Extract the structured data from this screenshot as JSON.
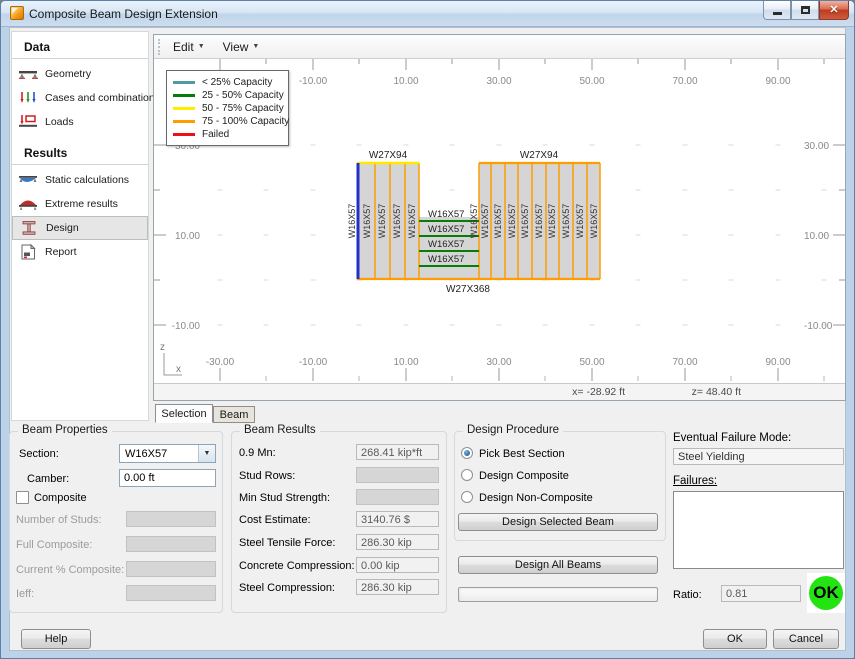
{
  "window": {
    "title": "Composite Beam Design Extension"
  },
  "sidebar": {
    "sections": [
      {
        "header": "Data",
        "items": [
          {
            "label": "Geometry"
          },
          {
            "label": "Cases and combinations"
          },
          {
            "label": "Loads"
          }
        ]
      },
      {
        "header": "Results",
        "items": [
          {
            "label": "Static calculations"
          },
          {
            "label": "Extreme results"
          },
          {
            "label": "Design",
            "selected": true
          },
          {
            "label": "Report"
          }
        ]
      }
    ]
  },
  "menubar": {
    "items": [
      {
        "label": "Edit"
      },
      {
        "label": "View"
      }
    ]
  },
  "legend": {
    "items": [
      {
        "label": "< 25% Capacity",
        "color": "#4f9ba0"
      },
      {
        "label": "25 - 50% Capacity",
        "color": "#067d06"
      },
      {
        "label": "50 - 75% Capacity",
        "color": "#ffee00"
      },
      {
        "label": "75 - 100% Capacity",
        "color": "#ff9c00"
      },
      {
        "label": "Failed",
        "color": "#ee1111"
      }
    ]
  },
  "plot": {
    "top_ticks": [
      "-10.00",
      "10.00",
      "30.00",
      "50.00",
      "70.00",
      "90.00"
    ],
    "bottom_ticks": [
      "-30.00",
      "-10.00",
      "10.00",
      "30.00",
      "50.00",
      "70.00",
      "90.00"
    ],
    "left_ticks": [
      "30.00",
      "10.00",
      "-10.00"
    ],
    "right_ticks": [
      "30.00",
      "10.00",
      "-10.00"
    ],
    "axis_z_label": "z",
    "axis_x_label": "x",
    "beams": {
      "top_left_girder": "W27X94",
      "top_right_girder": "W27X94",
      "bottom_girder": "W27X368",
      "vertical_beam": "W16X57",
      "middle_beam": "W16X57"
    },
    "colors": {
      "vertical": "#ff9d00",
      "selected": "#2230c8",
      "middle": "#067d06",
      "top_left": "#ffe900",
      "fill": "#d5d5d5"
    },
    "status": {
      "x": "x= -28.92 ft",
      "z": "z= 48.40 ft"
    }
  },
  "tabs": [
    {
      "label": "Selection",
      "active": true
    },
    {
      "label": "Beam",
      "active": false
    }
  ],
  "beam_properties": {
    "title": "Beam Properties",
    "section_label": "Section:",
    "section_value": "W16X57",
    "camber_label": "Camber:",
    "camber_value": "0.00 ft",
    "composite_label": "Composite",
    "composite_checked": false,
    "disabled_rows": [
      {
        "label": "Number of Studs:",
        "value": ""
      },
      {
        "label": "Full Composite:",
        "value": ""
      },
      {
        "label": "Current % Composite:",
        "value": ""
      },
      {
        "label": "Ieff:",
        "value": ""
      }
    ]
  },
  "beam_results": {
    "title": "Beam Results",
    "rows": [
      {
        "label": "0.9 Mn:",
        "value": "268.41 kip*ft",
        "state": "readonly"
      },
      {
        "label": "Stud Rows:",
        "value": "",
        "state": "disabled"
      },
      {
        "label": "Min Stud Strength:",
        "value": "",
        "state": "disabled"
      },
      {
        "label": "Cost Estimate:",
        "value": "3140.76 $",
        "state": "readonly"
      },
      {
        "label": "Steel Tensile Force:",
        "value": "286.30 kip",
        "state": "readonly"
      },
      {
        "label": "Concrete Compression:",
        "value": "0.00 kip",
        "state": "readonly"
      },
      {
        "label": "Steel Compression:",
        "value": "286.30 kip",
        "state": "readonly"
      }
    ]
  },
  "design_procedure": {
    "title": "Design Procedure",
    "options": [
      {
        "label": "Pick Best Section",
        "selected": true
      },
      {
        "label": "Design Composite",
        "selected": false
      },
      {
        "label": "Design Non-Composite",
        "selected": false
      }
    ],
    "design_selected_button": "Design Selected Beam",
    "design_all_button": "Design All Beams"
  },
  "failure_panel": {
    "mode_label": "Eventual Failure Mode:",
    "mode_value": "Steel Yielding",
    "failures_label": "Failures:",
    "ratio_label": "Ratio:",
    "ratio_value": "0.81",
    "status_badge": "OK",
    "status_color": "#24e312"
  },
  "footer": {
    "help": "Help",
    "ok": "OK",
    "cancel": "Cancel"
  }
}
